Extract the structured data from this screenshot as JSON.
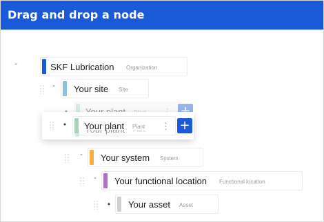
{
  "header": {
    "title": "Drag and drop a node"
  },
  "colors": {
    "accent": "#1a5ad8",
    "organization": "#1a5ad8",
    "site": "#8ec0de",
    "plant": "#a9d3b8",
    "system": "#f5b041",
    "functional_location": "#b070c8",
    "asset": "#cfcfcf"
  },
  "tree": {
    "organization": {
      "name": "SKF Lubrication",
      "type": "Organization",
      "icon": "chevron-down-icon"
    },
    "site": {
      "name": "Your site",
      "type": "Site",
      "icon": "chevron-down-icon"
    },
    "plant": {
      "name": "Your plant",
      "type": "Plant",
      "icon": "bullet-icon"
    },
    "system": {
      "name": "Your system",
      "type": "System",
      "icon": "chevron-down-icon"
    },
    "functional_location": {
      "name": "Your functional location",
      "type": "Functional location",
      "icon": "chevron-down-icon"
    },
    "asset": {
      "name": "Your asset",
      "type": "Asset",
      "icon": "bullet-icon"
    }
  },
  "dragging": {
    "name": "Your plant",
    "type": "Plant"
  },
  "glyphs": {
    "chevron": "ˇ",
    "bullet": "•",
    "kebab": "⋮",
    "plus": "+"
  }
}
